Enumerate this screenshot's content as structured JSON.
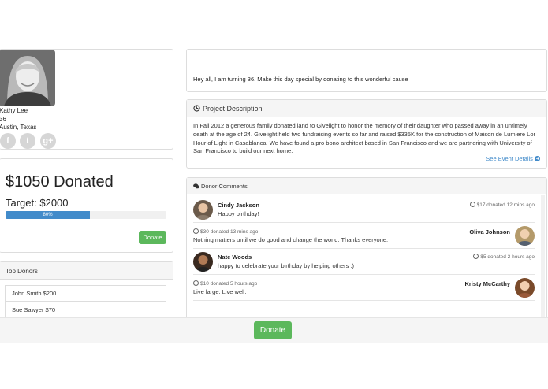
{
  "profile": {
    "name": "Kathy Lee",
    "age": "36",
    "location": "Austin, Texas",
    "social": [
      {
        "icon": "facebook-icon",
        "glyph": "f"
      },
      {
        "icon": "twitter-icon",
        "glyph": "t"
      },
      {
        "icon": "google-plus-icon",
        "glyph": "g+"
      }
    ]
  },
  "donation": {
    "donated": "$1050 Donated",
    "target": "Target: $2000",
    "progress_label": "80%",
    "progress_fraction": 0.525,
    "donate_label": "Donate"
  },
  "top_donors": {
    "title": "Top Donors",
    "items": [
      "John Smith $200",
      "Sue Sawyer $70"
    ]
  },
  "message": "Hey all, I am turning 36. Make this day special by donating to this wonderful cause",
  "project": {
    "title": "Project Description",
    "text": "In Fall 2012 a generous family donated land to Givelight to honor the memory of their daughter who passed away in an untimely death at the age of 24. Givelight held two fundraising events so far and raised $335K for the construction of Maison de Lumiere Lor Hour of Light in Casablanca. We have found a pro bono architect based in San Francisco and we are partnering with University of San Francisco to build our next home.",
    "event_link": "See Event Details"
  },
  "comments": {
    "title": "Donor Comments",
    "items": [
      {
        "name": "Cindy Jackson",
        "text": "Happy birthday!",
        "meta": "$17 donated 12 mins ago"
      },
      {
        "name": "Oliva Johnson",
        "text": "Nothing matters until we do good and change the world. Thanks everyone.",
        "meta": "$30 donated 13 mins ago"
      },
      {
        "name": "Nate Woods",
        "text": "happy to celebrate your birthday by helping others :)",
        "meta": "$5 donated 2 hours ago"
      },
      {
        "name": "Kristy McCarthy",
        "text": "Live large. Live well.",
        "meta": "$10 donated 5 hours ago"
      }
    ]
  },
  "bottom": {
    "donate_label": "Donate"
  },
  "colors": {
    "primary": "#428bca",
    "success": "#5cb85c",
    "panel_head": "#f5f5f5",
    "border": "#dddddd"
  }
}
